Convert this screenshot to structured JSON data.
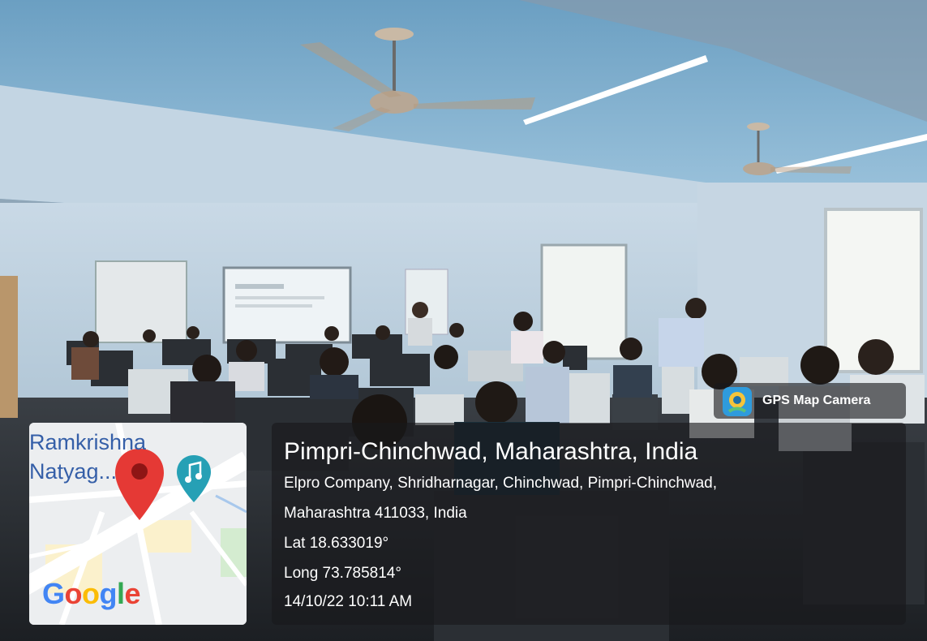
{
  "overlay": {
    "app_badge": "GPS Map Camera",
    "location_title": "Pimpri-Chinchwad, Maharashtra, India",
    "address_line1": "Elpro Company, Shridharnagar, Chinchwad, Pimpri-Chinchwad,",
    "address_line2": "Maharashtra 411033, India",
    "latitude": "Lat 18.633019°",
    "longitude": "Long 73.785814°",
    "datetime": "14/10/22 10:11 AM"
  },
  "map": {
    "place_label_line1": "Ramkrishna",
    "place_label_line2": "Natyag...",
    "provider_logo": "Google",
    "pin_icon": "map-pin-icon",
    "music_icon": "music-note-icon"
  },
  "colors": {
    "pin_red": "#e53935",
    "music_teal": "#26a0b5",
    "map_road": "#ffffff",
    "map_land": "#eceef0"
  }
}
